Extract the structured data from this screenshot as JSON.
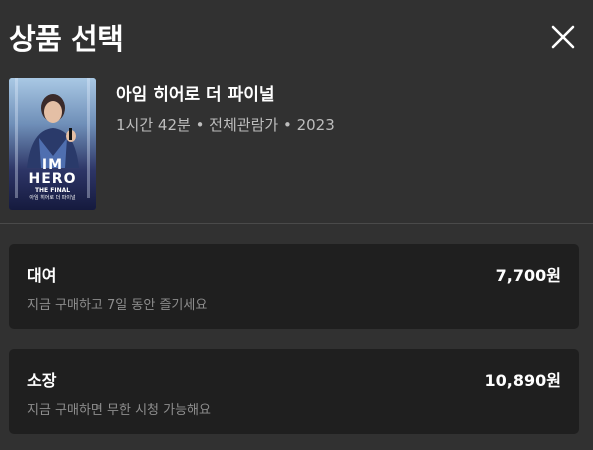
{
  "header": {
    "title": "상품 선택",
    "close_icon": "close-icon"
  },
  "product": {
    "title": "아임 히어로 더 파이널",
    "meta": "1시간 42분 • 전체관람가 • 2023",
    "poster": {
      "line1": "IM",
      "line2": "HERO",
      "line3": "THE FINAL",
      "line4": "아임 히어로 더 파이널"
    }
  },
  "options": [
    {
      "name": "대여",
      "price": "7,700원",
      "description": "지금 구매하고 7일 동안 즐기세요"
    },
    {
      "name": "소장",
      "price": "10,890원",
      "description": "지금 구매하면 무한 시청 가능해요"
    }
  ],
  "colors": {
    "background": "#313131",
    "card": "#1f1f1f",
    "text_primary": "#ffffff",
    "text_secondary": "#bdbdbd",
    "text_muted": "#8e8e8e"
  }
}
